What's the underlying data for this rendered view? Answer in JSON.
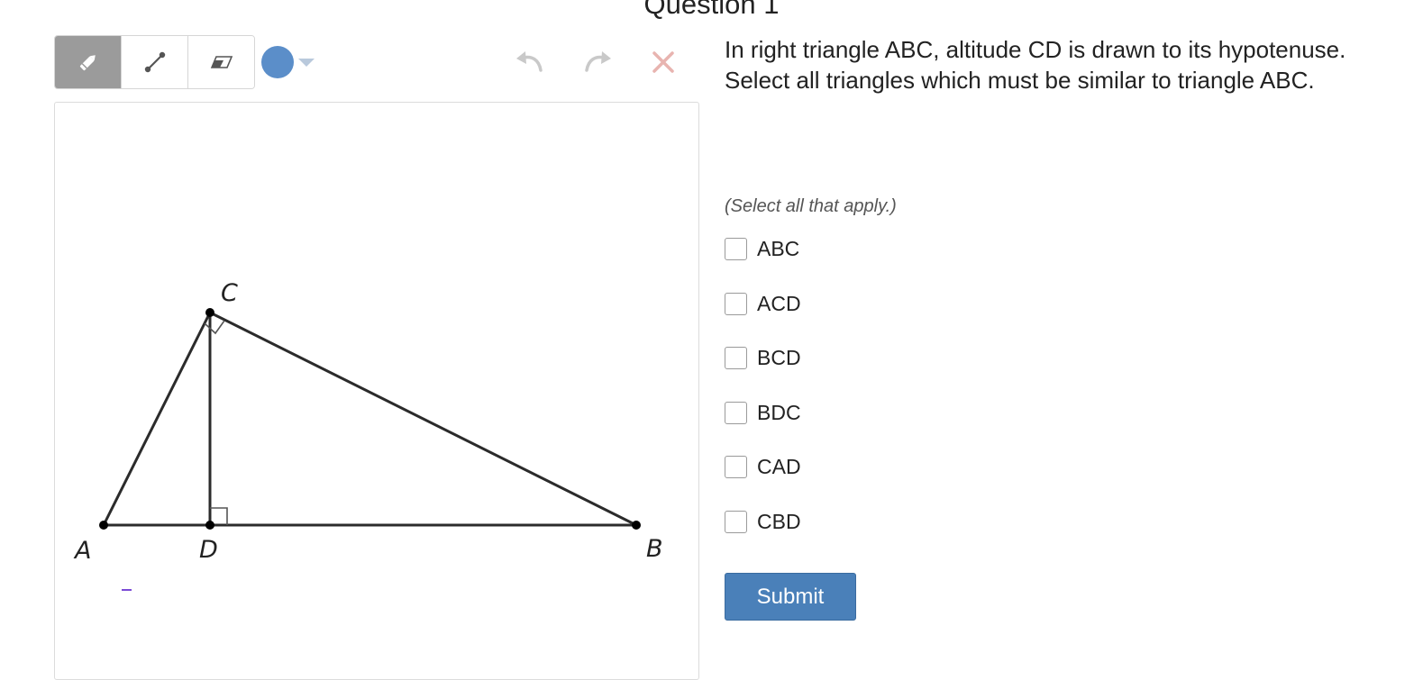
{
  "page": {
    "title": "Question 1"
  },
  "toolbar": {
    "tools": [
      {
        "icon": "pencil-icon",
        "active": true
      },
      {
        "icon": "line-tool-icon",
        "active": false
      },
      {
        "icon": "eraser-icon",
        "active": false
      }
    ],
    "color": "#5b8ec9",
    "undo_icon": "undo-icon",
    "redo_icon": "redo-icon",
    "clear_icon": "close-icon",
    "clear_color": "#e8b4b0"
  },
  "diagram": {
    "vertices": {
      "A": "A",
      "B": "B",
      "C": "C",
      "D": "D"
    },
    "right_angle_marks": [
      "C",
      "D"
    ],
    "stroke_color": "#000000",
    "stray_mark_color": "#7b4bd6"
  },
  "question": {
    "prompt": "In right triangle ABC, altitude CD is drawn to its hypotenuse. Select all triangles which must be similar to triangle ABC.",
    "instruction": "(Select all that apply.)",
    "options": [
      {
        "label": "ABC",
        "checked": false
      },
      {
        "label": "ACD",
        "checked": false
      },
      {
        "label": "BCD",
        "checked": false
      },
      {
        "label": "BDC",
        "checked": false
      },
      {
        "label": "CAD",
        "checked": false
      },
      {
        "label": "CBD",
        "checked": false
      }
    ],
    "submit_label": "Submit",
    "submit_color": "#4a80b9"
  }
}
